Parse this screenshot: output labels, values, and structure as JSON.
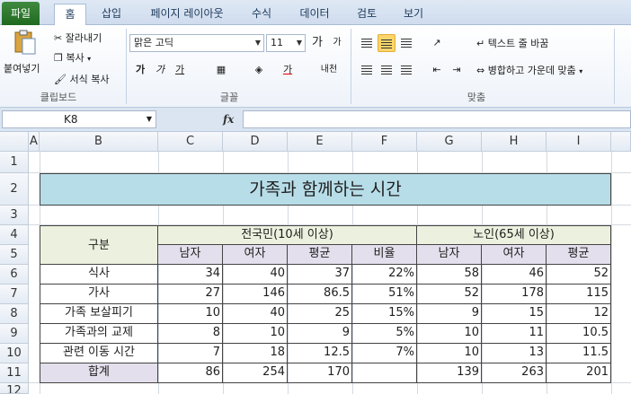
{
  "ribbon_tabs": [
    "파일",
    "홈",
    "삽입",
    "페이지 레이아웃",
    "수식",
    "데이터",
    "검토",
    "보기"
  ],
  "clipboard": {
    "paste": "붙여넣기",
    "cut": "잘라내기",
    "copy": "복사",
    "format_painter": "서식 복사",
    "label": "클립보드"
  },
  "font": {
    "name": "맑은 고딕",
    "size": "11",
    "label": "글꼴",
    "bold": "가",
    "italic": "가",
    "underline": "가",
    "font_color": "가",
    "grow": "가",
    "shrink": "가",
    "phonetic": "내천"
  },
  "alignment": {
    "wrap": "텍스트 줄 바꿈",
    "merge": "병합하고 가운데 맞춤",
    "label": "맞춤"
  },
  "formula_bar": {
    "cell_ref": "K8",
    "fx": "fx",
    "value": ""
  },
  "columns": [
    "A",
    "B",
    "C",
    "D",
    "E",
    "F",
    "G",
    "H",
    "I"
  ],
  "rows": [
    "1",
    "2",
    "3",
    "4",
    "5",
    "6",
    "7",
    "8",
    "9",
    "10",
    "11",
    "12"
  ],
  "sheet": {
    "title": "가족과 함께하는 시간",
    "header_category": "구분",
    "group_national": "전국민(10세 이상)",
    "group_elderly": "노인(65세 이상)",
    "sub_national": [
      "남자",
      "여자",
      "평균",
      "비율"
    ],
    "sub_elderly": [
      "남자",
      "여자",
      "평균"
    ],
    "data_rows": [
      {
        "label": "식사",
        "values": [
          "34",
          "40",
          "37",
          "22%",
          "58",
          "46",
          "52"
        ]
      },
      {
        "label": "가사",
        "values": [
          "27",
          "146",
          "86.5",
          "51%",
          "52",
          "178",
          "115"
        ]
      },
      {
        "label": "가족 보살피기",
        "values": [
          "10",
          "40",
          "25",
          "15%",
          "9",
          "15",
          "12"
        ]
      },
      {
        "label": "가족과의 교제",
        "values": [
          "8",
          "10",
          "9",
          "5%",
          "10",
          "11",
          "10.5"
        ]
      },
      {
        "label": "관련 이동 시간",
        "values": [
          "7",
          "18",
          "12.5",
          "7%",
          "10",
          "13",
          "11.5"
        ]
      },
      {
        "label": "합계",
        "values": [
          "86",
          "254",
          "170",
          "",
          "139",
          "263",
          "201"
        ]
      }
    ]
  }
}
